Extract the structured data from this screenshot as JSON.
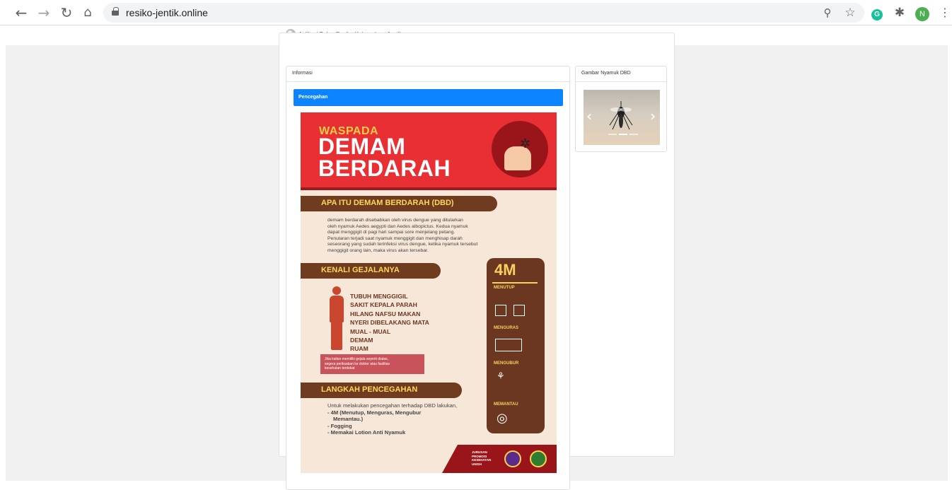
{
  "browser": {
    "url": "resiko-jentik.online",
    "profile_initial": "N",
    "icons": [
      "back-icon",
      "forward-icon",
      "reload-icon",
      "home-icon",
      "lock-icon",
      "zoom-icon",
      "star-icon",
      "grammarly-icon",
      "extensions-icon",
      "menu-icon"
    ]
  },
  "header": {
    "brand": "Aplikasi Pakar Resiko Keberadaan Jentik"
  },
  "info_card": {
    "title": "Informasi",
    "section_label": "Pencegahan"
  },
  "side_card": {
    "title": "Gambar Nyamuk DBD",
    "active_slide": 2,
    "slide_count": 3
  },
  "poster": {
    "waspada": "WASPADA",
    "demam": "DEMAM",
    "berdarah": "BERDARAH",
    "sec1": "APA ITU DEMAM BERDARAH (DBD)",
    "sec1_text": [
      "demam berdarah disebabkan oleh virus dengue yang ditularkan",
      "oleh nyamuk Aedes aegypti dan Aedes albopictus. Kedua nyamuk",
      "dapat menggigit di pagi hari sampai sore menjelang petang.",
      "Penularan terjadi saat nyamuk menggigit dan menghisap darah",
      "seseorang yang sudah terinfeksi virus dengue, ketika nyamuk tersebut",
      "menggigit orang lain, maka virus akan tersebar."
    ],
    "sec2": "KENALI GEJALANYA",
    "symptoms": [
      "TUBUH MENGGIGIL",
      "SAKIT KEPALA PARAH",
      "HILANG NAFSU MAKAN",
      "NYERI DIBELAKANG MATA",
      "MUAL - MUAL",
      "DEMAM",
      "RUAM"
    ],
    "note": [
      "Jika kalian memiliki gejala seperti diatas,",
      "segera periksakan ke dokter atau fasilitas",
      "kesehatan terdekat"
    ],
    "sec3": "LANGKAH PENCEGAHAN",
    "sec3_lines": [
      "Untuk melakukan pencegahan terhadap DBD lakukan,",
      "- 4M (Menutup, Menguras, Mengubur",
      "  Memantau.)",
      "- Fogging",
      "- Memakai Lotion Anti Nyamuk"
    ],
    "fourm": "4M",
    "fourm_items": [
      "MENUTUP",
      "MENGURAS",
      "MENGUBUR",
      "MEMANTAU"
    ],
    "footer_org": [
      "JURUSAN",
      "PROMOSI",
      "KESEHATAN",
      "UNISH"
    ]
  }
}
